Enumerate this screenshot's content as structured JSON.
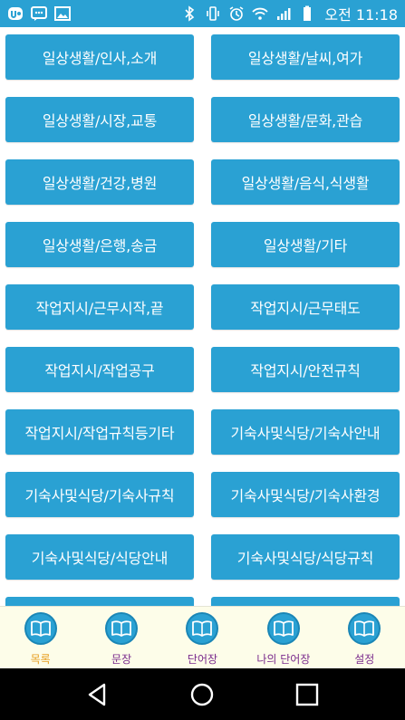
{
  "status_bar": {
    "time_text": "오전 11:18",
    "left_icons": [
      "app-notification-icon",
      "chat-notification-icon",
      "image-notification-icon"
    ],
    "right_icons": [
      "bluetooth-icon",
      "vibrate-icon",
      "alarm-icon",
      "wifi-icon",
      "signal-icon",
      "battery-icon"
    ]
  },
  "categories": [
    "일상생활/인사,소개",
    "일상생활/날씨,여가",
    "일상생활/시장,교통",
    "일상생활/문화,관습",
    "일상생활/건강,병원",
    "일상생활/음식,식생활",
    "일상생활/은행,송금",
    "일상생활/기타",
    "작업지시/근무시작,끝",
    "작업지시/근무태도",
    "작업지시/작업공구",
    "작업지시/안전규칙",
    "작업지시/작업규칙등기타",
    "기숙사및식당/기숙사안내",
    "기숙사및식당/기숙사규칙",
    "기숙사및식당/기숙사환경",
    "기숙사및식당/식당안내",
    "기숙사및식당/식당규칙",
    "",
    ""
  ],
  "bottom_nav": {
    "items": [
      {
        "label": "목록",
        "icon": "book-icon",
        "active": true
      },
      {
        "label": "문장",
        "icon": "book-icon",
        "active": false
      },
      {
        "label": "단어장",
        "icon": "book-icon",
        "active": false
      },
      {
        "label": "나의 단어장",
        "icon": "book-icon",
        "active": false
      },
      {
        "label": "설정",
        "icon": "book-icon",
        "active": false
      }
    ]
  },
  "system_nav": {
    "buttons": [
      "back-icon",
      "home-icon",
      "recents-icon"
    ]
  },
  "colors": {
    "accent": "#2aa1d3",
    "nav_background": "#fdfde9",
    "nav_label": "#7a2a8c",
    "nav_label_active": "#e79c1b"
  }
}
